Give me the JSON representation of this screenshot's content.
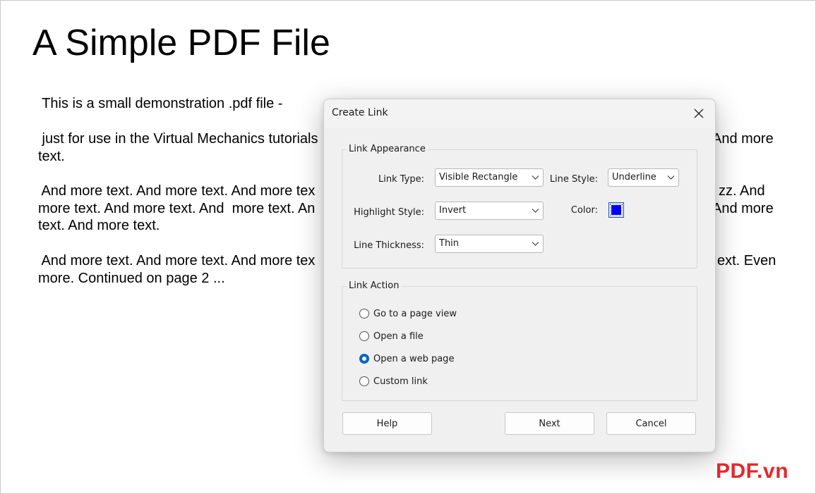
{
  "document": {
    "title": "A Simple PDF File",
    "lines": [
      " This is a small demonstration .pdf file -",
      " just for use in the Virtual Mechanics tutorials",
      "text.",
      " And more text. And more text. And more tex",
      "more text. And more text. And  more text. An",
      "text. And more text.",
      " And more text. And more text. And more tex",
      "more. Continued on page 2 ..."
    ],
    "right_fragments": [
      "And more",
      "zz. And",
      "And more",
      "ext. Even"
    ]
  },
  "dialog": {
    "title": "Create Link",
    "appearance": {
      "group_label": "Link Appearance",
      "link_type_label": "Link Type:",
      "link_type_value": "Visible Rectangle",
      "line_style_label": "Line Style:",
      "line_style_value": "Underline",
      "highlight_style_label": "Highlight Style:",
      "highlight_style_value": "Invert",
      "color_label": "Color:",
      "color_value": "#0000ff",
      "line_thickness_label": "Line Thickness:",
      "line_thickness_value": "Thin"
    },
    "action": {
      "group_label": "Link Action",
      "options": [
        {
          "label": "Go to a page view",
          "checked": false
        },
        {
          "label": "Open a file",
          "checked": false
        },
        {
          "label": "Open a web page",
          "checked": true
        },
        {
          "label": "Custom link",
          "checked": false
        }
      ]
    },
    "buttons": {
      "help": "Help",
      "next": "Next",
      "cancel": "Cancel"
    }
  },
  "watermark": "PDF.vn",
  "colors": {
    "accent": "#0067c0",
    "link_color": "#0000ff",
    "watermark": "#e8262b"
  }
}
